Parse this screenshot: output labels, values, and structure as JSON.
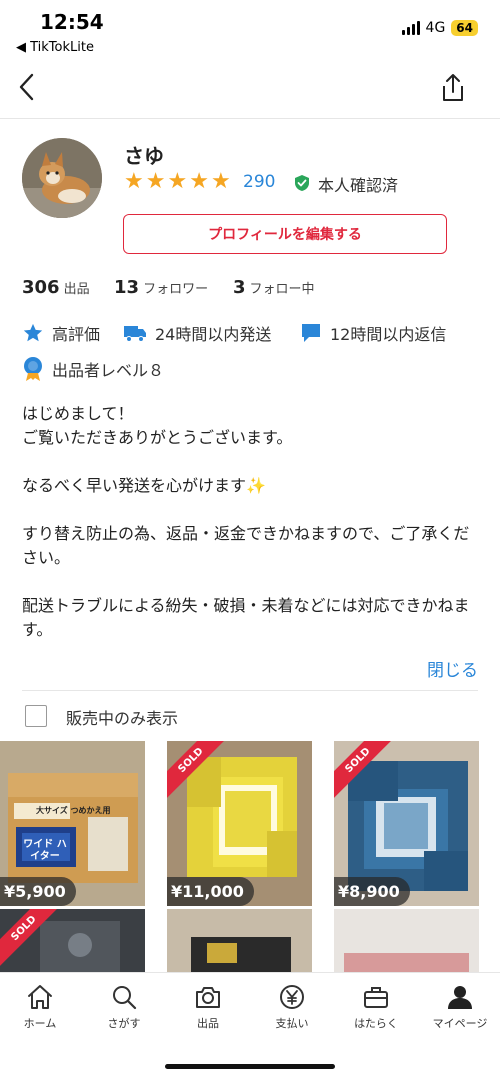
{
  "status_bar": {
    "time": "12:54",
    "back_app": "◀ TikTokLite",
    "network": "4G",
    "battery": "64"
  },
  "profile": {
    "name": "さゆ",
    "rating_count": "290",
    "verified_label": "本人確認済",
    "edit_button": "プロフィールを編集する"
  },
  "stats": [
    {
      "value": "306",
      "label": "出品"
    },
    {
      "value": "13",
      "label": "フォロワー"
    },
    {
      "value": "3",
      "label": "フォロー中"
    }
  ],
  "badges": {
    "high_rating": "高評価",
    "shipping": "24時間以内発送",
    "reply": "12時間以内返信",
    "level": "出品者レベル８"
  },
  "bio": "はじめまして！\nご覧いただきありがとうございます。\n\nなるべく早い発送を心がけます✨\n\nすり替え防止の為、返品・返金できかねますので、ご了承ください。\n\n配送トラブルによる紛失・破損・未着などには対応できかねます。",
  "close_link": "閉じる",
  "filter": {
    "label": "販売中のみ表示"
  },
  "items": [
    {
      "price": "¥5,900",
      "sold": false,
      "box_text": "大サイズ つめかえ用",
      "brand": "ワイド ハイター"
    },
    {
      "price": "¥11,000",
      "sold": true,
      "sold_label": "SOLD"
    },
    {
      "price": "¥8,900",
      "sold": true,
      "sold_label": "SOLD"
    },
    {
      "sold": true,
      "sold_label": "SOLD"
    },
    {
      "sold": false
    },
    {
      "sold": false
    }
  ],
  "tabs": [
    {
      "label": "ホーム",
      "icon": "home-icon"
    },
    {
      "label": "さがす",
      "icon": "search-icon"
    },
    {
      "label": "出品",
      "icon": "camera-icon"
    },
    {
      "label": "支払い",
      "icon": "yen-icon"
    },
    {
      "label": "はたらく",
      "icon": "briefcase-icon"
    },
    {
      "label": "マイページ",
      "icon": "person-icon"
    }
  ],
  "colors": {
    "accent_red": "#e0283d",
    "link_blue": "#2a86d8",
    "star": "#f5a623",
    "verified_green": "#2aa65a"
  }
}
